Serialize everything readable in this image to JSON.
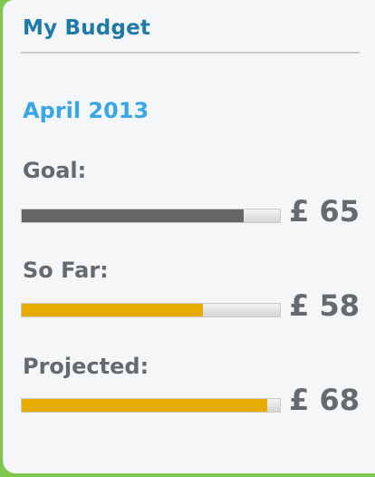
{
  "widget": {
    "title": "My Budget",
    "period": "April 2013"
  },
  "rows": [
    {
      "label": "Goal:",
      "amount": "£ 65",
      "fill_fraction": 0.86,
      "color": "#666666"
    },
    {
      "label": "So Far:",
      "amount": "£ 58",
      "fill_fraction": 0.7,
      "color": "#e6ad00"
    },
    {
      "label": "Projected:",
      "amount": "£ 68",
      "fill_fraction": 0.95,
      "color": "#e6ad00"
    }
  ]
}
